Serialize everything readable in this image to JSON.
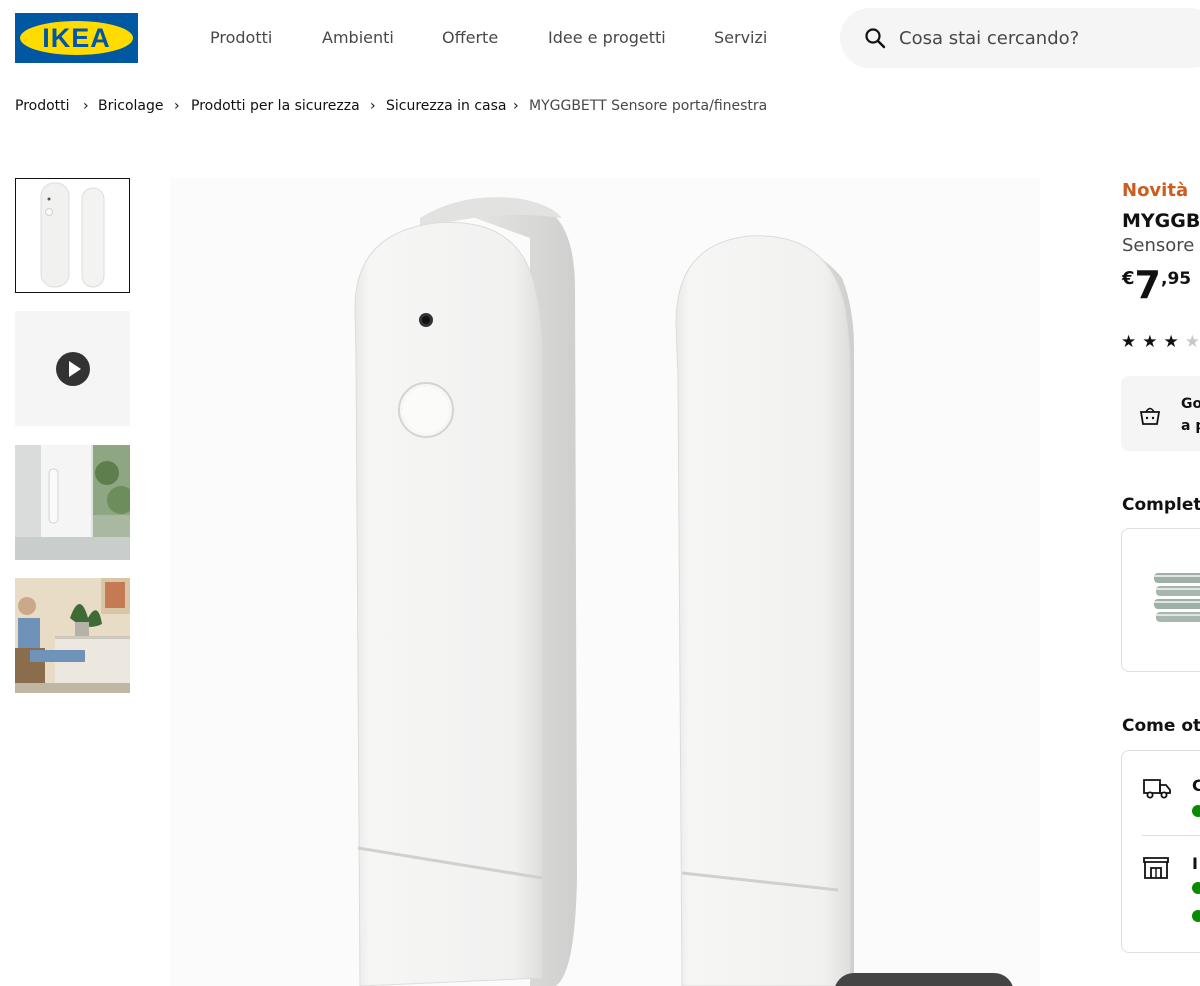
{
  "header": {
    "logo_text": "IKEA",
    "nav": [
      "Prodotti",
      "Ambienti",
      "Offerte",
      "Idee e progetti",
      "Servizi"
    ],
    "search": {
      "placeholder": "Cosa stai cercando?"
    }
  },
  "breadcrumb": {
    "items": [
      "Prodotti",
      "Bricolage",
      "Prodotti per la sicurezza",
      "Sicurezza in casa"
    ],
    "current": "MYGGBETT Sensore porta/finestra",
    "separator": "›"
  },
  "gallery": {
    "thumbnails": [
      {
        "kind": "product",
        "selected": true
      },
      {
        "kind": "video",
        "icon": "play-icon"
      },
      {
        "kind": "window-photo"
      },
      {
        "kind": "living-room-photo"
      }
    ]
  },
  "product": {
    "badge": "Novità",
    "name": "MYGGBE",
    "description": "Sensore",
    "price": {
      "currency": "€",
      "integer": "7",
      "decimal": ",95"
    },
    "rating": {
      "filled": 3,
      "total": 5
    },
    "promo_lines": [
      "Go",
      "a p"
    ]
  },
  "sections": {
    "complete_title": "Completa",
    "obtain_title": "Come ott",
    "delivery_label": "C",
    "store_label": "I"
  },
  "colors": {
    "ikea_blue": "#0058a3",
    "ikea_yellow": "#ffdb00",
    "new_badge": "#cc5d1e",
    "availability_green": "#0a8a00"
  }
}
